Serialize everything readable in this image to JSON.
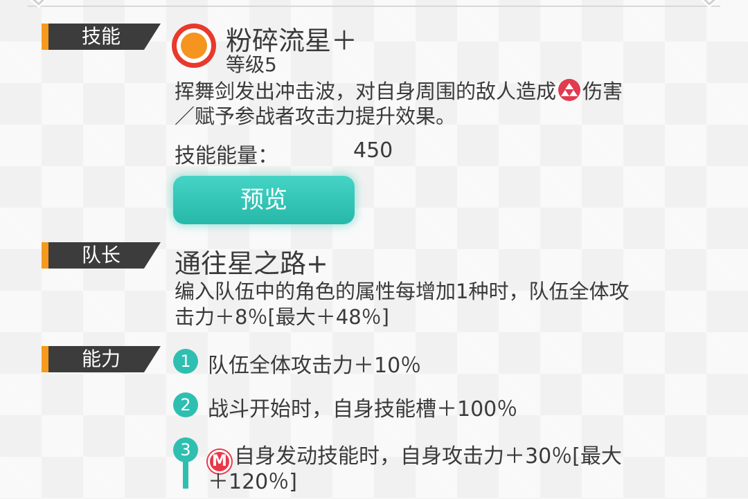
{
  "skill": {
    "section_label": "技能",
    "name": "粉碎流星＋",
    "level": "等级5",
    "desc_line1_a": "挥舞剑发出冲击波，对自身周围的敌人造成",
    "desc_line1_b": "伤害",
    "desc_line2": "／赋予参战者攻击力提升效果。",
    "energy_label": "技能能量：",
    "energy_value": "450",
    "preview_label": "预览",
    "element_icon": "fire-element-icon",
    "skill_icon": "skill-orb-icon"
  },
  "leader": {
    "section_label": "队长",
    "name": "通往星之路+",
    "desc_line1": "编入队伍中的角色的属性每增加1种时，队伍全体攻",
    "desc_line2": "击力＋8％[最大＋48％]"
  },
  "ability": {
    "section_label": "能力",
    "items": [
      {
        "num": "1",
        "text": "队伍全体攻击力＋10％"
      },
      {
        "num": "2",
        "text": "战斗开始时，自身技能槽＋100％"
      },
      {
        "num": "3",
        "icon_text": "M",
        "text_line1": "自身发动技能时，自身攻击力＋30％[最大",
        "text_line2": "＋120％]"
      }
    ]
  },
  "colors": {
    "accent_teal": "#2fbfb1",
    "label_orange": "#f59a1c",
    "label_dark": "#3c3c3c",
    "fire_red": "#e8394b"
  }
}
